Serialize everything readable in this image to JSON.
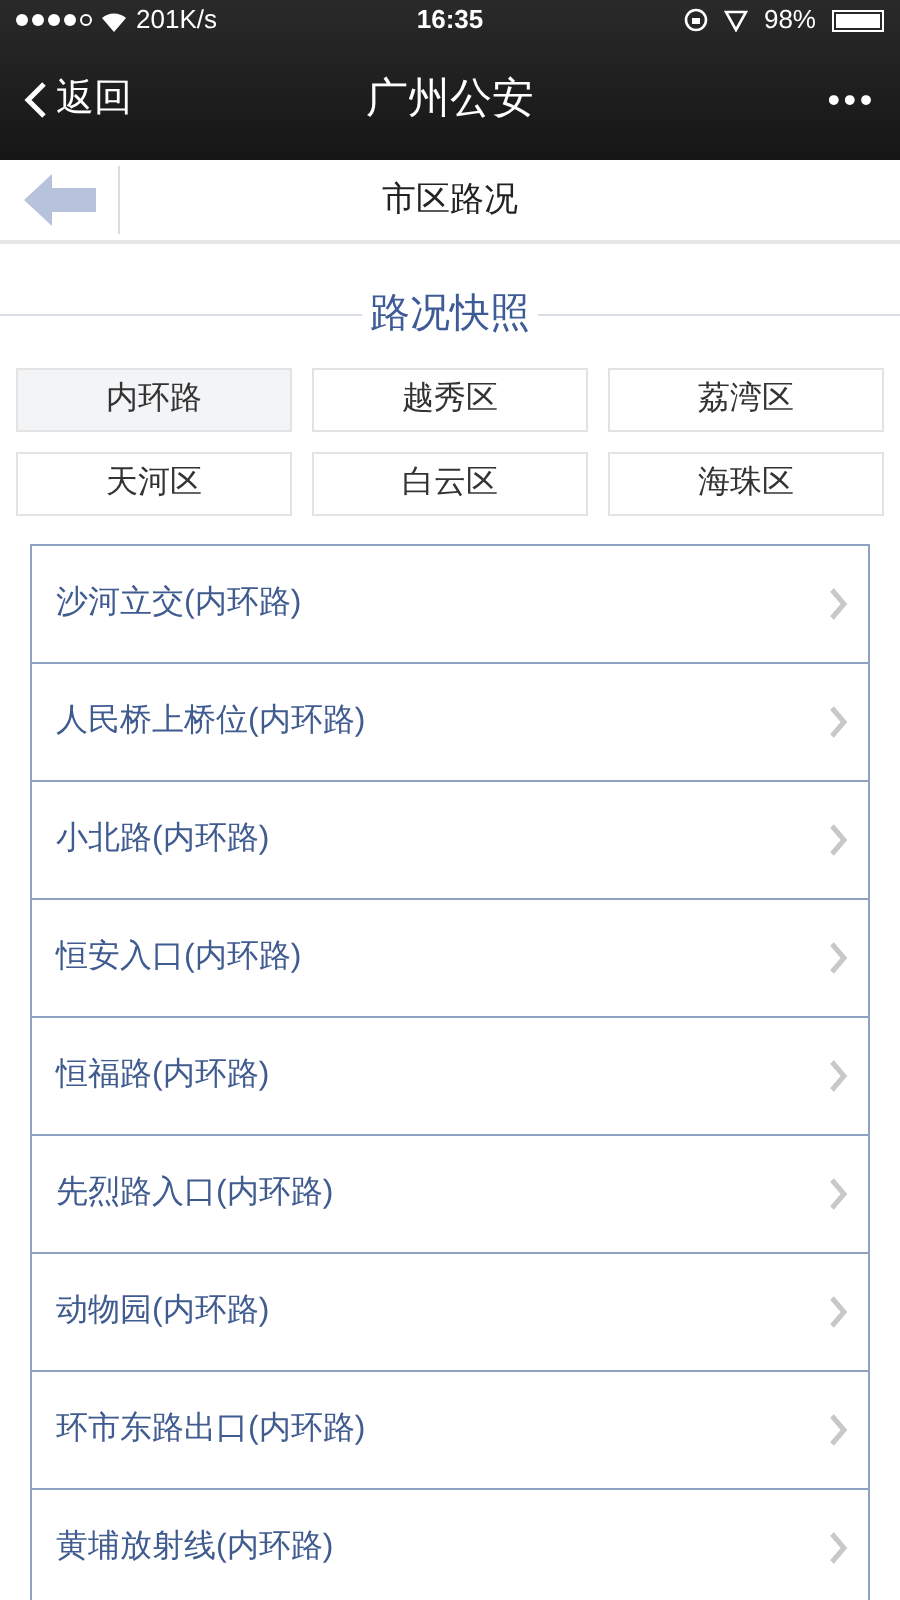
{
  "status_bar": {
    "signal_text": "201K/s",
    "time": "16:35",
    "battery": "98%"
  },
  "nav_bar": {
    "back": "返回",
    "title": "广州公安",
    "more": "•••"
  },
  "page_header": {
    "title": "市区路况"
  },
  "section": {
    "title": "路况快照"
  },
  "districts": [
    {
      "label": "内环路",
      "selected": true
    },
    {
      "label": "越秀区",
      "selected": false
    },
    {
      "label": "荔湾区",
      "selected": false
    },
    {
      "label": "天河区",
      "selected": false
    },
    {
      "label": "白云区",
      "selected": false
    },
    {
      "label": "海珠区",
      "selected": false
    }
  ],
  "roads": [
    "沙河立交(内环路)",
    "人民桥上桥位(内环路)",
    "小北路(内环路)",
    "恒安入口(内环路)",
    "恒福路(内环路)",
    "先烈路入口(内环路)",
    "动物园(内环路)",
    "环市东路出口(内环路)",
    "黄埔放射线(内环路)"
  ]
}
